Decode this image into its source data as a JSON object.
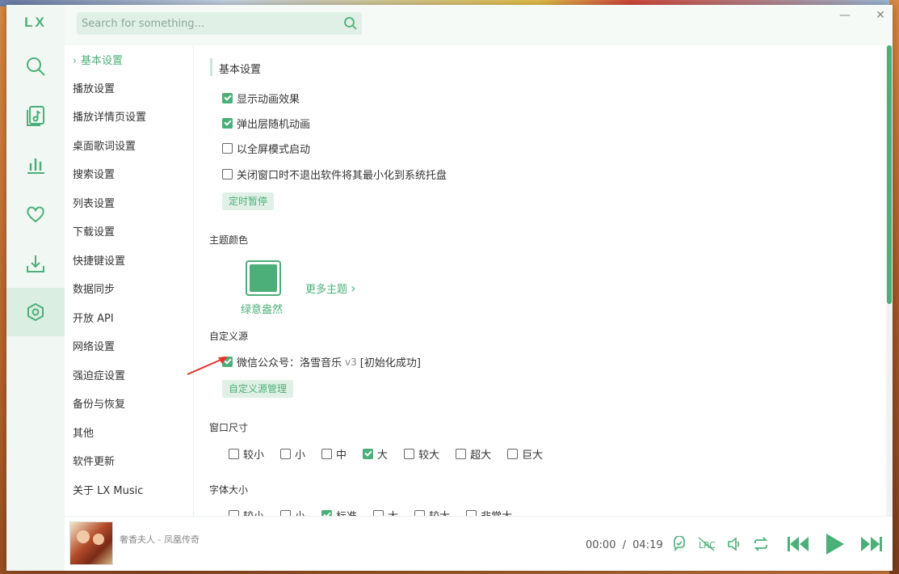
{
  "app": {
    "logo": "LX",
    "accent_color": "#4caf79"
  },
  "rail": [
    {
      "name": "search-icon"
    },
    {
      "name": "music-library-icon"
    },
    {
      "name": "charts-icon"
    },
    {
      "name": "heart-icon"
    },
    {
      "name": "download-icon"
    },
    {
      "name": "settings-icon",
      "active": true
    }
  ],
  "search": {
    "placeholder": "Search for something..."
  },
  "window_controls": {
    "minimize": "—",
    "close": "✕"
  },
  "nav": {
    "items": [
      {
        "label": "基本设置",
        "active": true
      },
      {
        "label": "播放设置"
      },
      {
        "label": "播放详情页设置"
      },
      {
        "label": "桌面歌词设置"
      },
      {
        "label": "搜索设置"
      },
      {
        "label": "列表设置"
      },
      {
        "label": "下载设置"
      },
      {
        "label": "快捷键设置"
      },
      {
        "label": "数据同步"
      },
      {
        "label": "开放 API"
      },
      {
        "label": "网络设置"
      },
      {
        "label": "强迫症设置"
      },
      {
        "label": "备份与恢复"
      },
      {
        "label": "其他"
      },
      {
        "label": "软件更新"
      },
      {
        "label": "关于 LX Music"
      }
    ]
  },
  "basic": {
    "title": "基本设置",
    "options": [
      {
        "label": "显示动画效果",
        "checked": true
      },
      {
        "label": "弹出层随机动画",
        "checked": true
      },
      {
        "label": "以全屏模式启动",
        "checked": false
      },
      {
        "label": "关闭窗口时不退出软件将其最小化到系统托盘",
        "checked": false
      }
    ],
    "timer_button": "定时暂停"
  },
  "theme": {
    "title": "主题颜色",
    "current_label": "绿意盎然",
    "more_label": "更多主题",
    "more_chevron": "›"
  },
  "custom_source": {
    "title": "自定义源",
    "source_label": "微信公众号：洛雪音乐",
    "version": "v3",
    "status": "[初始化成功]",
    "checked": true,
    "manage_button": "自定义源管理"
  },
  "window_size": {
    "title": "窗口尺寸",
    "options": [
      {
        "label": "较小",
        "checked": false
      },
      {
        "label": "小",
        "checked": false
      },
      {
        "label": "中",
        "checked": false
      },
      {
        "label": "大",
        "checked": true
      },
      {
        "label": "较大",
        "checked": false
      },
      {
        "label": "超大",
        "checked": false
      },
      {
        "label": "巨大",
        "checked": false
      }
    ]
  },
  "font_size": {
    "title": "字体大小",
    "options": [
      {
        "label": "较小",
        "checked": false
      },
      {
        "label": "小",
        "checked": false
      },
      {
        "label": "标准",
        "checked": true
      },
      {
        "label": "大",
        "checked": false
      },
      {
        "label": "较大",
        "checked": false
      },
      {
        "label": "非常大",
        "checked": false
      }
    ]
  },
  "player": {
    "song": "奢香夫人 - 凤凰传奇",
    "current_time": "00:00",
    "separator": "/",
    "duration": "04:19",
    "controls": [
      "loop-comment-icon",
      "lyric-off-icon",
      "volume-icon",
      "repeat-icon",
      "prev-icon",
      "play-icon",
      "next-icon"
    ]
  }
}
